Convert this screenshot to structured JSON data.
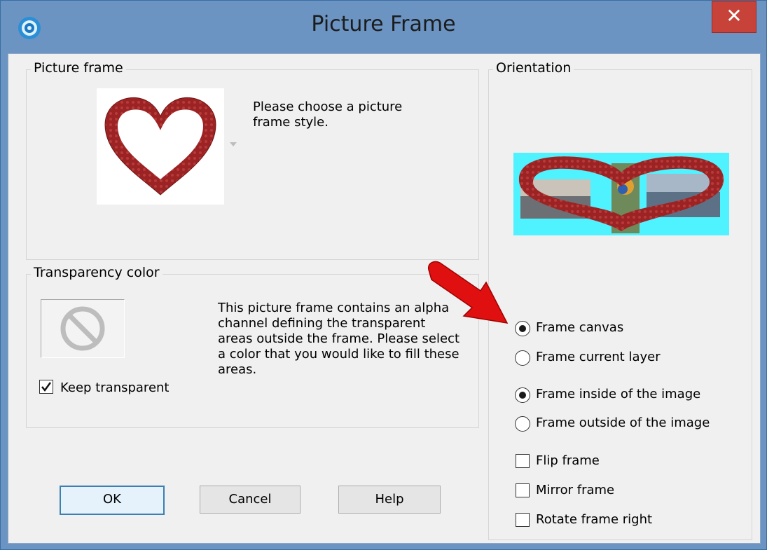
{
  "window": {
    "title": "Picture Frame",
    "close_glyph": "✕",
    "app_icon": "camera-lens-icon"
  },
  "picture_frame": {
    "label": "Picture frame",
    "hint": "Please choose a picture frame style."
  },
  "transparency": {
    "label": "Transparency color",
    "description": "This picture frame contains an alpha channel defining the transparent areas outside the frame.  Please select a color that you would like to fill these areas.",
    "keep_transparent_label": "Keep transparent",
    "keep_transparent_checked": true,
    "swatch_icon": "prohibited-icon"
  },
  "orientation": {
    "label": "Orientation",
    "frame_canvas": "Frame canvas",
    "frame_current_layer": "Frame current layer",
    "frame_inside": "Frame inside of the image",
    "frame_outside": "Frame outside of the image",
    "flip_frame": "Flip frame",
    "mirror_frame": "Mirror frame",
    "rotate_frame_right": "Rotate frame right",
    "selected_target": "Frame canvas",
    "selected_position": "Frame inside of the image"
  },
  "buttons": {
    "ok": "OK",
    "cancel": "Cancel",
    "help": "Help"
  },
  "colors": {
    "title_bar": "#6b94c3",
    "close_button": "#c7433a",
    "frame_red": "#9c2323",
    "preview_bg": "#4ff2ff",
    "annotation_arrow": "#e01010"
  }
}
